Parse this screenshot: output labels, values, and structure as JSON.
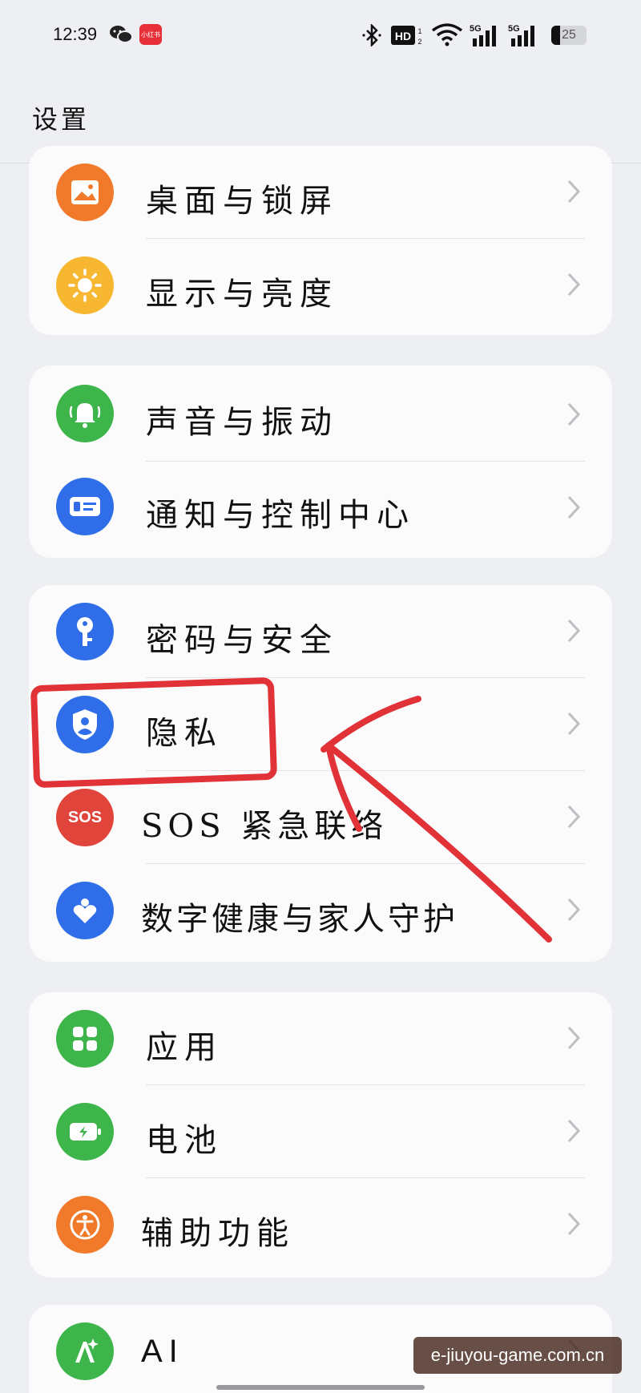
{
  "status_bar": {
    "time": "12:39",
    "network_badges": [
      "HD",
      "5G",
      "5G"
    ],
    "battery_level": "25",
    "battery_percent": 25
  },
  "header": {
    "title": "设置"
  },
  "groups": [
    {
      "items": [
        {
          "label": "桌面与锁屏",
          "icon": "wallpaper-icon",
          "color": "#f07a2a"
        },
        {
          "label": "显示与亮度",
          "icon": "sun-icon",
          "color": "#f7b731"
        }
      ]
    },
    {
      "items": [
        {
          "label": "声音与振动",
          "icon": "bell-icon",
          "color": "#3db54a"
        },
        {
          "label": "通知与控制中心",
          "icon": "notification-icon",
          "color": "#2f6ee8"
        }
      ]
    },
    {
      "items": [
        {
          "label": "密码与安全",
          "icon": "key-icon",
          "color": "#2f6ee8"
        },
        {
          "label": "隐私",
          "icon": "privacy-shield-icon",
          "color": "#2f6ee8"
        },
        {
          "label": "SOS 紧急联络",
          "icon": "sos-icon",
          "icon_text": "SOS",
          "color": "#e0443a"
        },
        {
          "label": "数字健康与家人守护",
          "icon": "heart-icon",
          "color": "#2f6ee8"
        }
      ]
    },
    {
      "items": [
        {
          "label": "应用",
          "icon": "apps-grid-icon",
          "color": "#3db54a"
        },
        {
          "label": "电池",
          "icon": "battery-icon",
          "color": "#3db54a"
        },
        {
          "label": "辅助功能",
          "icon": "accessibility-icon",
          "color": "#f07a2a"
        }
      ]
    },
    {
      "items": [
        {
          "label": "AI",
          "icon": "ai-sparkle-icon",
          "color": "#3db54a"
        }
      ]
    }
  ],
  "watermark": "e-jiuyou-game.com.cn",
  "annotation_color": "#e13238"
}
